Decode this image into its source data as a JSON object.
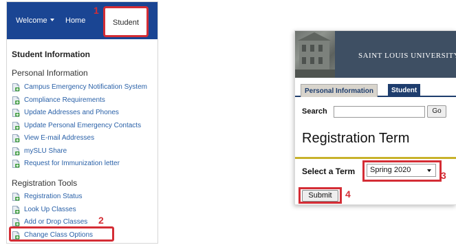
{
  "left_panel": {
    "nav": {
      "welcome_label": "Welcome",
      "home_label": "Home",
      "student_label": "Student",
      "student_step": "1"
    },
    "section_title": "Student Information",
    "personal": {
      "title": "Personal Information",
      "links": [
        "Campus Emergency Notification System",
        "Compliance Requirements",
        "Update Addresses and Phones",
        "Update Personal Emergency Contacts",
        "View E-mail Addresses",
        "mySLU Share",
        "Request for Immunization letter"
      ]
    },
    "registration": {
      "title": "Registration Tools",
      "links": [
        "Registration Status",
        "Look Up Classes",
        "Add or Drop Classes",
        "Change Class Options"
      ],
      "step": "2"
    },
    "link_icon": "document-page-icon"
  },
  "right_panel": {
    "university_name": "SAINT LOUIS UNIVERSITY",
    "tabs": {
      "personal": "Personal Information",
      "student": "Student"
    },
    "search_label": "Search",
    "go_label": "Go",
    "page_title": "Registration Term",
    "term_label": "Select a Term",
    "term_value": "Spring 2020",
    "term_step": "3",
    "submit_label": "Submit",
    "submit_step": "4"
  },
  "colors": {
    "nav_blue": "#1a4593",
    "highlight_red": "#d42d35",
    "link_blue": "#2a61a8",
    "slu_header": "#3e4f63",
    "tab_navy": "#1e3d6d",
    "rule_gold": "#c8b22a"
  }
}
